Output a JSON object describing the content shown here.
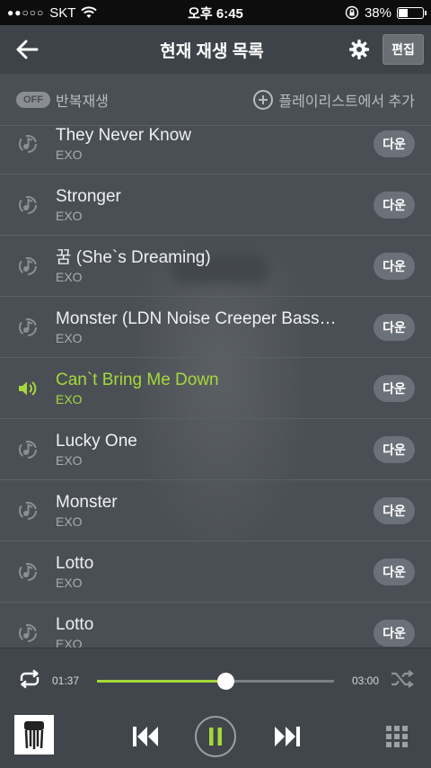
{
  "status_bar": {
    "signal": "●●○○○",
    "carrier": "SKT",
    "time": "오후 6:45",
    "battery_pct": "38%",
    "battery_level": 0.38
  },
  "header": {
    "title": "현재 재생 목록",
    "edit_label": "편집"
  },
  "options": {
    "repeat_toggle": "OFF",
    "repeat_label": "반복재생",
    "add_playlist_label": "플레이리스트에서 추가"
  },
  "tracks": [
    {
      "title": "They Never Know",
      "artist": "EXO",
      "download": "다운",
      "playing": false
    },
    {
      "title": "Stronger",
      "artist": "EXO",
      "download": "다운",
      "playing": false
    },
    {
      "title": "꿈 (She`s Dreaming)",
      "artist": "EXO",
      "download": "다운",
      "playing": false
    },
    {
      "title": "Monster (LDN Noise Creeper Bass…",
      "artist": "EXO",
      "download": "다운",
      "playing": false
    },
    {
      "title": "Can`t Bring Me Down",
      "artist": "EXO",
      "download": "다운",
      "playing": true
    },
    {
      "title": "Lucky One",
      "artist": "EXO",
      "download": "다운",
      "playing": false
    },
    {
      "title": "Monster",
      "artist": "EXO",
      "download": "다운",
      "playing": false
    },
    {
      "title": "Lotto",
      "artist": "EXO",
      "download": "다운",
      "playing": false
    },
    {
      "title": "Lotto",
      "artist": "EXO",
      "download": "다운",
      "playing": false
    }
  ],
  "player": {
    "elapsed": "01:37",
    "duration": "03:00",
    "progress": 0.54
  },
  "colors": {
    "accent": "#a4d93b",
    "background": "#4a4f55",
    "header": "#3e4349"
  }
}
